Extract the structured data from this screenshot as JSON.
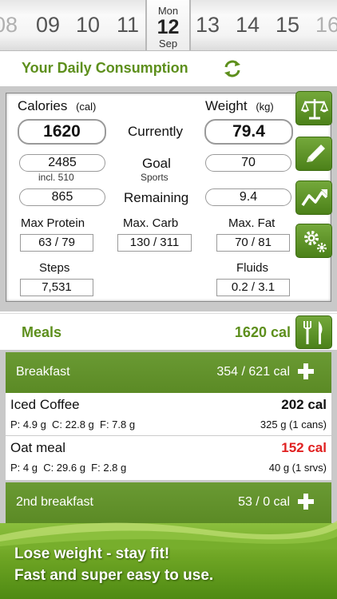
{
  "date_strip": {
    "days": [
      "08",
      "09",
      "10",
      "11",
      "13",
      "14",
      "15",
      "16"
    ],
    "selected": {
      "weekday": "Mon",
      "day": "12",
      "month": "Sep"
    }
  },
  "header": {
    "title": "Your Daily Consumption"
  },
  "stats": {
    "calories_label": "Calories",
    "calories_unit": "(cal)",
    "weight_label": "Weight",
    "weight_unit": "(kg)",
    "currently_label": "Currently",
    "calories_current": "1620",
    "weight_current": "79.4",
    "goal_label": "Goal",
    "goal_sub": "Sports",
    "calories_goal": "2485",
    "calories_goal_note": "incl. 510",
    "weight_goal": "70",
    "remaining_label": "Remaining",
    "calories_remaining": "865",
    "weight_remaining": "9.4",
    "protein_label": "Max Protein",
    "protein_value": "63 / 79",
    "carb_label": "Max. Carb",
    "carb_value": "130 / 311",
    "fat_label": "Max. Fat",
    "fat_value": "70 / 81",
    "steps_label": "Steps",
    "steps_value": "7,531",
    "fluids_label": "Fluids",
    "fluids_value": "0.2 / 3.1"
  },
  "side_buttons": [
    "scale-icon",
    "pencil-icon",
    "chart-icon",
    "gears-icon"
  ],
  "meals": {
    "label": "Meals",
    "total": "1620 cal",
    "groups": [
      {
        "name": "Breakfast",
        "summary": "354 / 621 cal",
        "items": [
          {
            "name": "Iced Coffee",
            "cal": "202 cal",
            "macros": "P: 4.9 g  C: 22.8 g  F: 7.8 g",
            "portion": "325 g (1 cans)"
          },
          {
            "name": "Oat meal",
            "cal": "152 cal",
            "macros": "P: 4 g  C: 29.6 g  F: 2.8 g",
            "portion": "40 g (1 srvs)"
          }
        ]
      },
      {
        "name": "2nd breakfast",
        "summary": "53 / 0 cal"
      }
    ]
  },
  "promo": {
    "line1": "Lose weight - stay fit!",
    "line2": "Fast and super easy to use."
  },
  "colors": {
    "accent_green": "#5d8f1c",
    "button_green": "#5b8a25",
    "alert_red": "#e02020"
  }
}
